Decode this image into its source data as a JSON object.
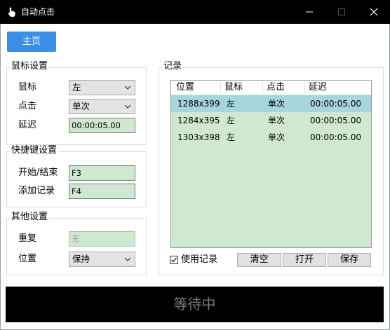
{
  "window": {
    "title": "自动点击",
    "app_icon": "hand-pointer-icon",
    "controls": [
      "minimize-icon",
      "maximize-icon",
      "close-icon"
    ]
  },
  "home_button": "主页",
  "mouse_settings": {
    "title": "鼠标设置",
    "button_label": "鼠标",
    "button_value": "左",
    "click_label": "点击",
    "click_value": "单次",
    "delay_label": "延迟",
    "delay_value": "00:00:05.00"
  },
  "hotkey_settings": {
    "title": "快捷键设置",
    "start_stop_label": "开始/结束",
    "start_stop_value": "F3",
    "add_record_label": "添加记录",
    "add_record_value": "F4"
  },
  "other_settings": {
    "title": "其他设置",
    "repeat_label": "重复",
    "repeat_value": "无",
    "position_label": "位置",
    "position_value": "保持"
  },
  "records": {
    "title": "记录",
    "columns": [
      "位置",
      "鼠标",
      "点击",
      "延迟"
    ],
    "rows": [
      [
        "1288x399",
        "左",
        "单次",
        "00:00:05.00"
      ],
      [
        "1284x395",
        "左",
        "单次",
        "00:00:05.00"
      ],
      [
        "1303x398",
        "左",
        "单次",
        "00:00:05.00"
      ]
    ],
    "selected_row": 0,
    "use_records_label": "使用记录",
    "use_records_checked": true,
    "clear_label": "清空",
    "open_label": "打开",
    "save_label": "保存"
  },
  "status_text": "等待中",
  "colors": {
    "accent": "#3d8ee6",
    "field_bg": "#cfe8cf",
    "selected_row": "#a6d6dc",
    "titlebar": "#000000"
  }
}
